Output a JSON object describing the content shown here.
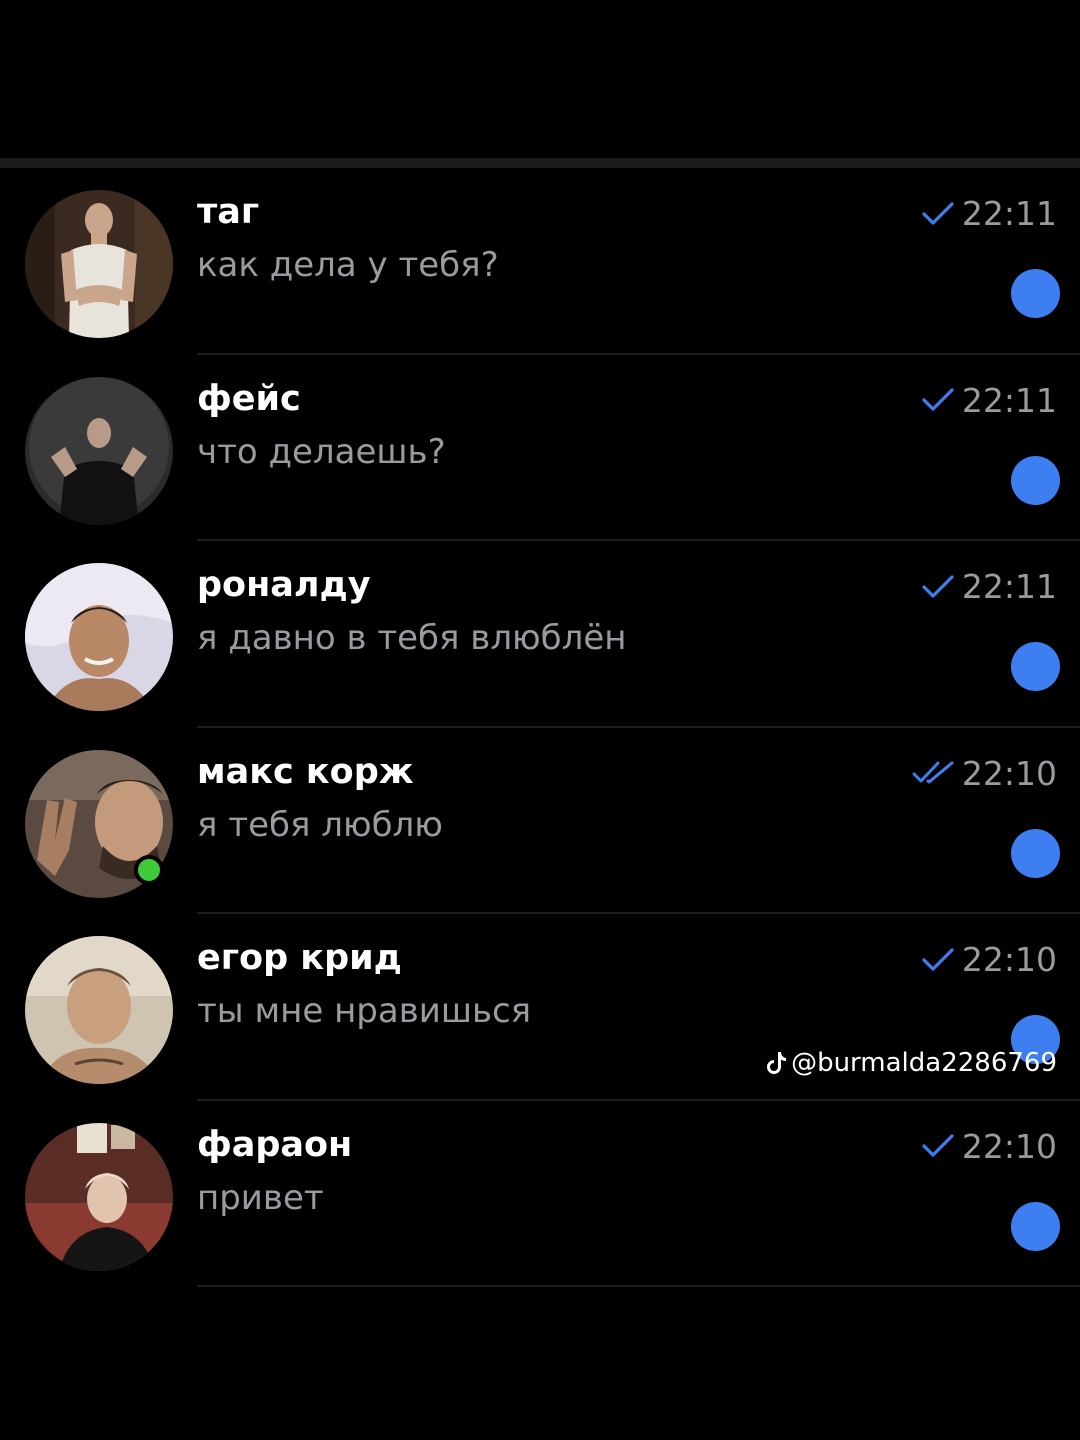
{
  "colors": {
    "background": "#000000",
    "name_text": "#ffffff",
    "secondary_text": "#9a9aa0",
    "check": "#3d7ff0",
    "unread_badge": "#3d7ff0",
    "online_indicator": "#3fcb38"
  },
  "chats": [
    {
      "name": "таг",
      "message": "как дела у тебя?",
      "time": "22:11",
      "status_icon": "single-check-icon",
      "unread": true,
      "online": false
    },
    {
      "name": "фейс",
      "message": "что делаешь?",
      "time": "22:11",
      "status_icon": "single-check-icon",
      "unread": true,
      "online": false
    },
    {
      "name": "роналду",
      "message": "я давно в тебя влюблён",
      "time": "22:11",
      "status_icon": "single-check-icon",
      "unread": true,
      "online": false
    },
    {
      "name": "макс корж",
      "message": "я тебя люблю",
      "time": "22:10",
      "status_icon": "double-check-icon",
      "unread": true,
      "online": true
    },
    {
      "name": "егор крид",
      "message": "ты мне нравишься",
      "time": "22:10",
      "status_icon": "single-check-icon",
      "unread": true,
      "online": false
    },
    {
      "name": "фараон",
      "message": "привет",
      "time": "22:10",
      "status_icon": "single-check-icon",
      "unread": true,
      "online": false
    }
  ],
  "watermark": {
    "icon": "tiktok-icon",
    "text": "@burmalda2286769"
  }
}
